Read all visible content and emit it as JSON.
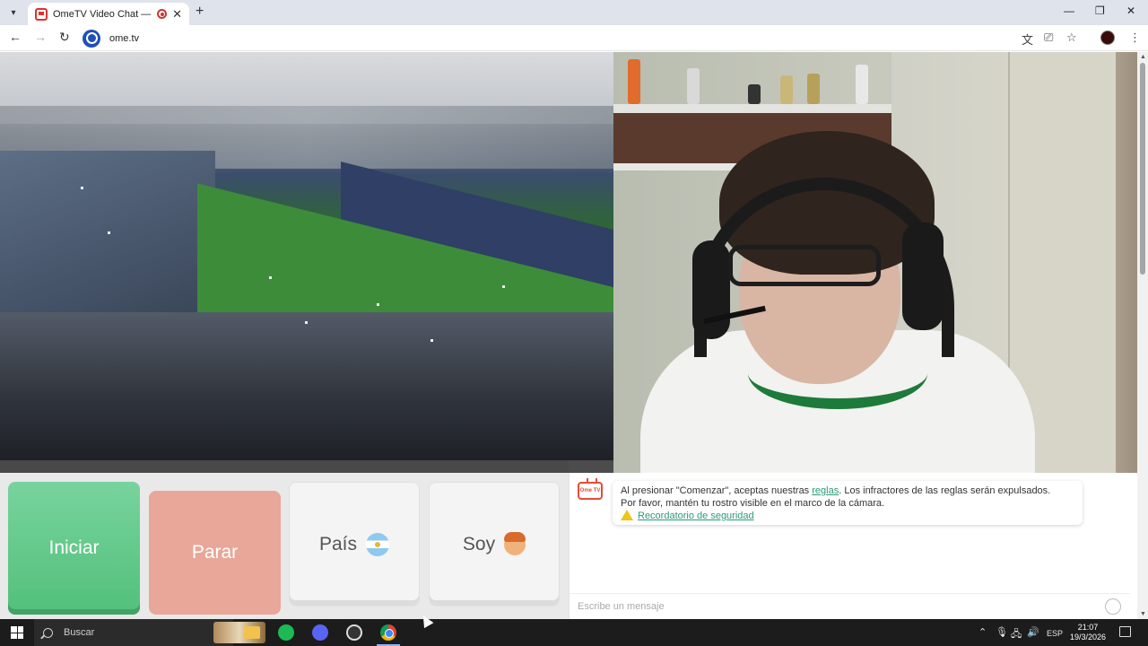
{
  "browser": {
    "tab_title": "OmeTV Video Chat — Ome",
    "tab_close": "✕",
    "new_tab": "+",
    "url": "ome.tv",
    "window_controls": {
      "minimize": "—",
      "maximize": "❐",
      "close": "✕"
    }
  },
  "controls": {
    "start_label": "Iniciar",
    "stop_label": "Parar",
    "country_label": "País",
    "gender_label": "Soy"
  },
  "chat": {
    "bot_icon_text": "Ome TV",
    "notice_prefix": "Al presionar \"Comenzar\", aceptas nuestras ",
    "rules_link": "reglas",
    "notice_suffix": ". Los infractores de las reglas serán expulsados.",
    "notice_line2": "Por favor, mantén tu rostro visible en el marco de la cámara.",
    "safety_link": "Recordatorio de seguridad",
    "input_placeholder": "Escribe un mensaje"
  },
  "taskbar": {
    "search_placeholder": "Buscar",
    "language": "ESP",
    "time": "21:07",
    "date": "19/3/2026"
  },
  "colors": {
    "start_button": "#5cc885",
    "stop_button": "#e8a798",
    "link": "#2b9a76",
    "bot_icon": "#e24d3a"
  }
}
